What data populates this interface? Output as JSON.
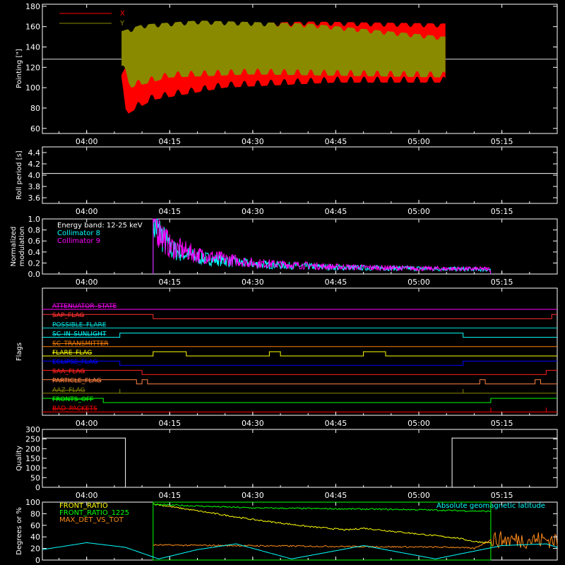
{
  "time_ticks": [
    "04:00",
    "04:15",
    "04:30",
    "04:45",
    "05:00",
    "05:15"
  ],
  "chart_data": [
    {
      "id": "pointing",
      "type": "line",
      "ylabel": "Pointing [\"]",
      "ylim": [
        55,
        182
      ],
      "yticks": [
        60,
        80,
        100,
        120,
        140,
        160,
        180
      ],
      "reference_line": 128,
      "legend": [
        {
          "name": "X",
          "color": "#ff0000"
        },
        {
          "name": "Y",
          "color": "#8a8a00"
        }
      ],
      "time_range": [
        "04:06",
        "05:05"
      ],
      "series": [
        {
          "name": "X",
          "color": "#ff0000",
          "upper": [
            {
              "t": "04:06",
              "v": 110
            },
            {
              "t": "04:10",
              "v": 150
            },
            {
              "t": "04:20",
              "v": 162
            },
            {
              "t": "04:40",
              "v": 165
            },
            {
              "t": "05:05",
              "v": 163
            }
          ],
          "lower": [
            {
              "t": "04:06",
              "v": 125
            },
            {
              "t": "04:07",
              "v": 73
            },
            {
              "t": "04:12",
              "v": 88
            },
            {
              "t": "04:25",
              "v": 100
            },
            {
              "t": "04:45",
              "v": 105
            },
            {
              "t": "05:05",
              "v": 105
            }
          ]
        },
        {
          "name": "Y",
          "color": "#8a8a00",
          "upper": [
            {
              "t": "04:06",
              "v": 155
            },
            {
              "t": "04:10",
              "v": 162
            },
            {
              "t": "04:20",
              "v": 166
            },
            {
              "t": "04:40",
              "v": 163
            },
            {
              "t": "05:05",
              "v": 150
            }
          ],
          "lower": [
            {
              "t": "04:06",
              "v": 125
            },
            {
              "t": "04:08",
              "v": 100
            },
            {
              "t": "04:15",
              "v": 110
            },
            {
              "t": "04:30",
              "v": 113
            },
            {
              "t": "05:05",
              "v": 110
            }
          ]
        }
      ]
    },
    {
      "id": "roll-period",
      "type": "line",
      "ylabel": "Roll period [s]",
      "ylim": [
        3.5,
        4.5
      ],
      "yticks": [
        3.6,
        3.8,
        4.0,
        4.2,
        4.4
      ],
      "value": 4.03
    },
    {
      "id": "modulation",
      "type": "line",
      "ylabel_lines": [
        "Normalized",
        "modulation"
      ],
      "ylim": [
        0,
        1
      ],
      "yticks": [
        0.0,
        0.2,
        0.4,
        0.6,
        0.8,
        1.0
      ],
      "legend": [
        {
          "name": "Energy band: 12-25 keV",
          "color": "#ffffff"
        },
        {
          "name": "Collimator 8",
          "color": "#00ffff"
        },
        {
          "name": "Collimator 9",
          "color": "#ff00ff"
        }
      ],
      "time_range": [
        "04:12",
        "05:13"
      ],
      "series": [
        {
          "name": "Collimator 8",
          "color": "#00ffff",
          "envelope": [
            {
              "t": "04:12",
              "v": 0.0
            },
            {
              "t": "04:12",
              "v": 0.95
            },
            {
              "t": "04:15",
              "v": 0.45
            },
            {
              "t": "04:20",
              "v": 0.3
            },
            {
              "t": "04:30",
              "v": 0.18
            },
            {
              "t": "04:45",
              "v": 0.12
            },
            {
              "t": "05:00",
              "v": 0.1
            },
            {
              "t": "05:13",
              "v": 0.08
            }
          ]
        },
        {
          "name": "Collimator 9",
          "color": "#ff00ff",
          "envelope": [
            {
              "t": "04:12",
              "v": 0.0
            },
            {
              "t": "04:12",
              "v": 1.0
            },
            {
              "t": "04:15",
              "v": 0.5
            },
            {
              "t": "04:20",
              "v": 0.35
            },
            {
              "t": "04:30",
              "v": 0.2
            },
            {
              "t": "04:45",
              "v": 0.13
            },
            {
              "t": "05:00",
              "v": 0.1
            },
            {
              "t": "05:13",
              "v": 0.09
            }
          ]
        }
      ]
    },
    {
      "id": "flags",
      "type": "step",
      "ylabel": "Flags",
      "flags": [
        {
          "name": "ATTENUATOR_STATE",
          "color": "#ff00ff",
          "segments": [
            [
              "03:52",
              "05:25",
              0
            ]
          ]
        },
        {
          "name": "SAP_FLAG",
          "color": "#ff3030",
          "segments": [
            [
              "03:52",
              "04:12",
              1
            ],
            [
              "04:12",
              "05:24",
              0
            ],
            [
              "05:24",
              "05:25",
              1
            ]
          ]
        },
        {
          "name": "POSSIBLE_FLARE",
          "color": "#00dddd",
          "segments": [
            [
              "03:52",
              "05:25",
              0
            ]
          ]
        },
        {
          "name": "SC_IN_SUNLIGHT",
          "color": "#00ffff",
          "segments": [
            [
              "03:52",
              "04:06",
              0
            ],
            [
              "04:06",
              "05:08",
              1
            ],
            [
              "05:08",
              "05:25",
              0
            ]
          ]
        },
        {
          "name": "SC_TRANSMITTER",
          "color": "#ff8000",
          "segments": [
            [
              "03:52",
              "05:25",
              0
            ]
          ]
        },
        {
          "name": "FLARE_FLAG",
          "color": "#ffff00",
          "segments": [
            [
              "03:52",
              "04:12",
              0
            ],
            [
              "04:12",
              "04:18",
              1
            ],
            [
              "04:18",
              "04:33",
              0
            ],
            [
              "04:33",
              "04:35",
              1
            ],
            [
              "04:35",
              "04:50",
              0
            ],
            [
              "04:50",
              "04:54",
              1
            ],
            [
              "04:54",
              "05:25",
              0
            ]
          ]
        },
        {
          "name": "ECLIPSE_FLAG",
          "color": "#0000ff",
          "segments": [
            [
              "03:52",
              "04:06",
              1
            ],
            [
              "04:06",
              "05:08",
              0
            ],
            [
              "05:08",
              "05:25",
              1
            ]
          ]
        },
        {
          "name": "SAA_FLAG",
          "color": "#ff2020",
          "segments": [
            [
              "03:52",
              "04:10",
              1
            ],
            [
              "04:10",
              "05:23",
              0
            ],
            [
              "05:23",
              "05:25",
              1
            ]
          ]
        },
        {
          "name": "PARTICLE_FLAG",
          "color": "#ff8040",
          "segments": [
            [
              "03:52",
              "04:09",
              1
            ],
            [
              "04:09",
              "04:10",
              0
            ],
            [
              "04:10",
              "04:11",
              1
            ],
            [
              "04:11",
              "05:11",
              0
            ],
            [
              "05:11",
              "05:12",
              1
            ],
            [
              "05:12",
              "05:21",
              0
            ],
            [
              "05:21",
              "05:22",
              1
            ],
            [
              "05:22",
              "05:25",
              0
            ]
          ]
        },
        {
          "name": "AAZ_FLAG",
          "color": "#8a8a00",
          "segments": [
            [
              "03:52",
              "05:25",
              0
            ]
          ],
          "spikes": [
            "04:06",
            "05:08"
          ]
        },
        {
          "name": "FRONTS_OFF",
          "color": "#00ff00",
          "segments": [
            [
              "03:52",
              "04:03",
              1
            ],
            [
              "04:03",
              "05:13",
              0
            ],
            [
              "05:13",
              "05:25",
              1
            ]
          ]
        },
        {
          "name": "BAD_PACKETS",
          "color": "#ff0000",
          "segments": [
            [
              "03:52",
              "05:25",
              0
            ]
          ],
          "spikes": [
            "05:13",
            "05:23"
          ]
        }
      ]
    },
    {
      "id": "quality",
      "type": "step",
      "ylabel": "Quality",
      "ylim": [
        0,
        300
      ],
      "yticks": [
        0,
        50,
        100,
        150,
        200,
        250,
        300
      ],
      "segments": [
        [
          "03:52",
          "04:07",
          255
        ],
        [
          "04:07",
          "05:06",
          0
        ],
        [
          "05:06",
          "05:25",
          255
        ]
      ]
    },
    {
      "id": "front-ratio",
      "type": "line",
      "ylabel": "Degrees or %",
      "ylim": [
        0,
        100
      ],
      "yticks": [
        0,
        20,
        40,
        60,
        80,
        100
      ],
      "legend": [
        {
          "name": "FRONT_RATIO",
          "color": "#ffff00"
        },
        {
          "name": "FRONT_RATIO_1225",
          "color": "#00ff00"
        },
        {
          "name": "MAX_DET_VS_TOT",
          "color": "#ff8c1a"
        }
      ],
      "annotation": {
        "text": "Absolute geomagnetic latitude",
        "color": "#00ffff"
      },
      "series": [
        {
          "name": "FRONT_RATIO",
          "color": "#ffff00",
          "points": [
            {
              "t": "04:12",
              "v": 97
            },
            {
              "t": "04:20",
              "v": 85
            },
            {
              "t": "04:30",
              "v": 70
            },
            {
              "t": "04:40",
              "v": 58
            },
            {
              "t": "04:47",
              "v": 52
            },
            {
              "t": "04:50",
              "v": 55
            },
            {
              "t": "05:00",
              "v": 45
            },
            {
              "t": "05:07",
              "v": 38
            },
            {
              "t": "05:10",
              "v": 32
            },
            {
              "t": "05:13",
              "v": 30
            }
          ]
        },
        {
          "name": "FRONT_RATIO_1225",
          "color": "#00ff00",
          "points": [
            {
              "t": "04:12",
              "v": 96
            },
            {
              "t": "04:30",
              "v": 90
            },
            {
              "t": "05:00",
              "v": 87
            },
            {
              "t": "05:13",
              "v": 84
            }
          ]
        },
        {
          "name": "MAX_DET_VS_TOT",
          "color": "#ff8c1a",
          "points": [
            {
              "t": "04:12",
              "v": 26
            },
            {
              "t": "04:40",
              "v": 24
            },
            {
              "t": "05:07",
              "v": 22
            },
            {
              "t": "05:10",
              "v": 20
            },
            {
              "t": "05:13",
              "v": 35
            },
            {
              "t": "05:25",
              "v": 35
            }
          ]
        },
        {
          "name": "Absolute geomagnetic latitude",
          "color": "#00ffff",
          "points": [
            {
              "t": "03:52",
              "v": 18
            },
            {
              "t": "04:00",
              "v": 30
            },
            {
              "t": "04:07",
              "v": 22
            },
            {
              "t": "04:13",
              "v": 2
            },
            {
              "t": "04:20",
              "v": 18
            },
            {
              "t": "04:27",
              "v": 28
            },
            {
              "t": "04:37",
              "v": 2
            },
            {
              "t": "04:50",
              "v": 25
            },
            {
              "t": "05:03",
              "v": 2
            },
            {
              "t": "05:15",
              "v": 25
            },
            {
              "t": "05:23",
              "v": 28
            },
            {
              "t": "05:25",
              "v": 22
            }
          ]
        }
      ],
      "frame_green": [
        "04:12",
        "05:13"
      ]
    }
  ]
}
